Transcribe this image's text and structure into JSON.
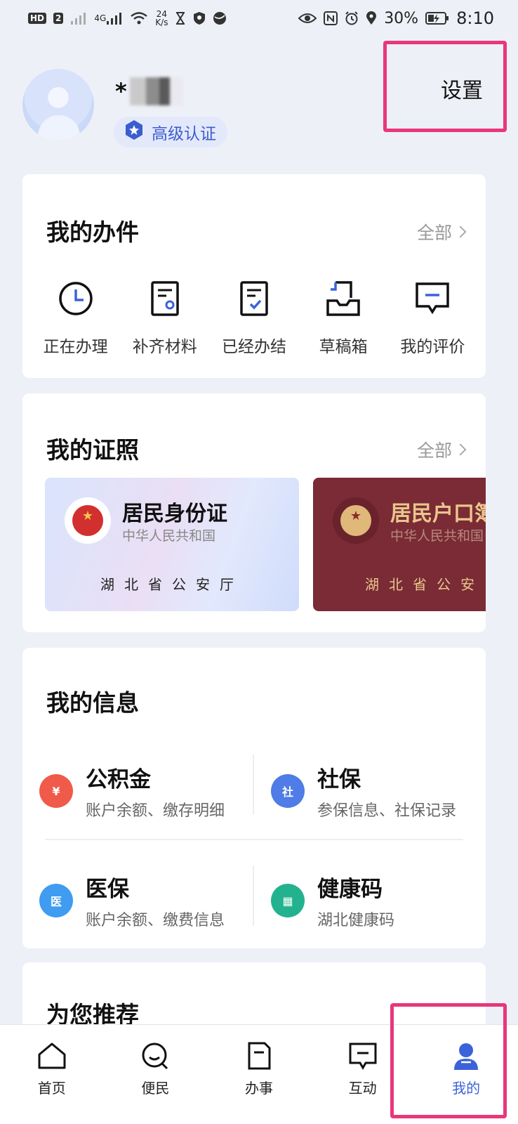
{
  "status_bar": {
    "hd_badge": "HD",
    "sim_badge": "2",
    "net_type": "4G",
    "speed_value": "24",
    "speed_unit": "K/s",
    "battery": "30%",
    "time": "8:10"
  },
  "profile": {
    "name_visible": "*",
    "cert_label": "高级认证",
    "settings_label": "设置"
  },
  "my_tasks": {
    "title": "我的办件",
    "more": "全部",
    "items": [
      {
        "label": "正在办理",
        "icon": "clock-icon"
      },
      {
        "label": "补齐材料",
        "icon": "document-stamp-icon"
      },
      {
        "label": "已经办结",
        "icon": "document-check-icon"
      },
      {
        "label": "草稿箱",
        "icon": "inbox-tray-icon"
      },
      {
        "label": "我的评价",
        "icon": "comment-icon"
      }
    ]
  },
  "my_licenses": {
    "title": "我的证照",
    "more": "全部",
    "items": [
      {
        "name": "居民身份证",
        "sub": "中华人民共和国",
        "issuer": "湖北省公安厅"
      },
      {
        "name": "居民户口簿",
        "sub": "中华人民共和国",
        "issuer": "湖北省公安"
      }
    ]
  },
  "my_info": {
    "title": "我的信息",
    "items": [
      {
        "title": "公积金",
        "sub": "账户余额、缴存明细",
        "icon_text": "¥",
        "color": "#f05a4b"
      },
      {
        "title": "社保",
        "sub": "参保信息、社保记录",
        "icon_text": "社",
        "color": "#4f7ce6"
      },
      {
        "title": "医保",
        "sub": "账户余额、缴费信息",
        "icon_text": "医",
        "color": "#3f9cf0"
      },
      {
        "title": "健康码",
        "sub": "湖北健康码",
        "icon_text": "▦",
        "color": "#22b38e"
      }
    ]
  },
  "recommend": {
    "title": "为您推荐"
  },
  "bottom_nav": {
    "items": [
      {
        "label": "首页",
        "icon": "home-icon"
      },
      {
        "label": "便民",
        "icon": "search-chat-icon"
      },
      {
        "label": "办事",
        "icon": "document-icon"
      },
      {
        "label": "互动",
        "icon": "message-icon"
      },
      {
        "label": "我的",
        "icon": "user-icon",
        "active": true
      }
    ]
  },
  "colors": {
    "accent": "#3a63d9",
    "highlight": "#e8377a",
    "background": "#eef0f8"
  }
}
